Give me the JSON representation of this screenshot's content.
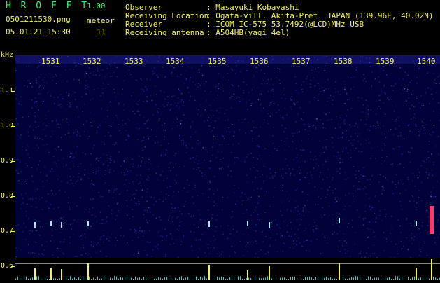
{
  "header": {
    "app_title": "H R O F F T",
    "version": "1.00",
    "filename": "0501211530.png",
    "meteor_label": "meteor",
    "datetime": "05.01.21 15:30",
    "meteor_count": "11",
    "info_labels": [
      "Observer",
      "Receiving Location",
      "Receiver",
      "Receiving antenna"
    ],
    "info_values": [
      ": Masayuki Kobayashi",
      ": Ogata-vill. Akita-Pref. JAPAN (139.96E, 40.02N)",
      ": ICOM IC-575 53.7492(@LCD)MHz USB",
      ": A504HB(yagi 4el)"
    ]
  },
  "axis": {
    "unit": "kHz",
    "freq_labels": [
      "1.1",
      "1.0",
      "0.9",
      "0.8",
      "0.7",
      "0.6"
    ],
    "minute_labels": [
      "1531",
      "1532",
      "1533",
      "1534",
      "1535",
      "1536",
      "1537",
      "1538",
      "1539",
      "1540"
    ]
  },
  "colors": {
    "header_green": "#3cf06a",
    "header_yellow": "#f4f25a",
    "background": "#02023a",
    "noise": "#3a3ad8",
    "baseline": "#f4f25a",
    "meteor": "#ff3b6b"
  }
}
